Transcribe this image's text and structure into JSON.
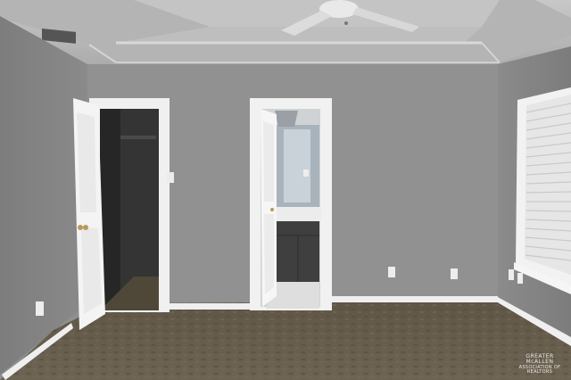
{
  "photo": {
    "subject": "empty-bedroom-interior",
    "colors": {
      "wall": "#8f8f8f",
      "ceiling": "#b9b9b9",
      "trim": "#f2f2f2",
      "carpet": "#6b6152",
      "door": "#f4f4f4",
      "closet_dark": "#2f2f2f",
      "vanity": "#3f3f3f"
    }
  },
  "watermark": {
    "line1": "GREATER McALLEN",
    "line2": "ASSOCIATION OF REALTORS"
  }
}
